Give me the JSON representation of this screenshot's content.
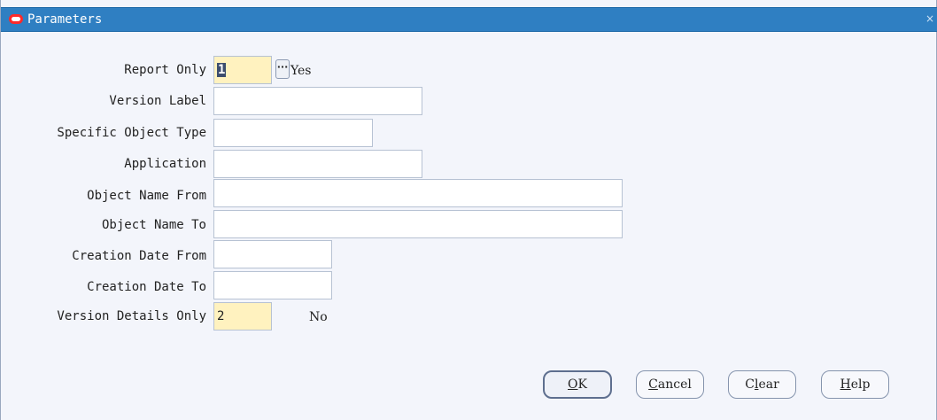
{
  "window": {
    "title": "Parameters",
    "close_glyph": "×",
    "icon": "oracle-logo-icon"
  },
  "fields": [
    {
      "label": "Report Only",
      "value": "1",
      "description": "Yes",
      "required": true
    },
    {
      "label": "Version Label",
      "value": ""
    },
    {
      "label": "Specific Object Type",
      "value": ""
    },
    {
      "label": "Application",
      "value": ""
    },
    {
      "label": "Object Name From",
      "value": ""
    },
    {
      "label": "Object Name To",
      "value": ""
    },
    {
      "label": "Creation Date From",
      "value": ""
    },
    {
      "label": "Creation Date To",
      "value": ""
    },
    {
      "label": "Version Details Only",
      "value": "2",
      "description": "No",
      "required": true
    }
  ],
  "lov_button_glyph": "···",
  "buttons": {
    "ok": {
      "pre": "",
      "mnemonic": "O",
      "post": "K"
    },
    "cancel": {
      "pre": "",
      "mnemonic": "C",
      "post": "ancel"
    },
    "clear": {
      "pre": "C",
      "mnemonic": "l",
      "post": "ear"
    },
    "help": {
      "pre": "",
      "mnemonic": "H",
      "post": "elp"
    }
  },
  "colors": {
    "title_bar": "#2f7fc2",
    "required_field": "#fff2bf",
    "background": "#f3f5fb"
  }
}
